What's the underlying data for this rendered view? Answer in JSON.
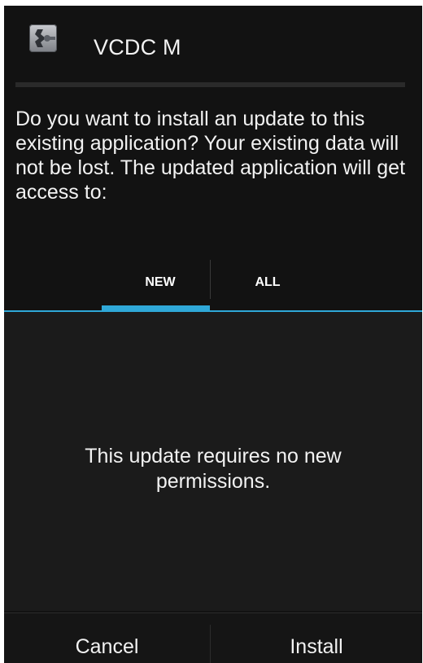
{
  "app": {
    "title": "VCDC M",
    "icon": "app-wrench-icon"
  },
  "dialog": {
    "message": "Do you want to install an update to this existing application? Your existing data will not be lost. The updated application will get access to:",
    "tabs": [
      {
        "label": "NEW",
        "selected": true
      },
      {
        "label": "ALL",
        "selected": false
      }
    ],
    "content_text": "This update requires no new permissions."
  },
  "buttons": {
    "cancel": "Cancel",
    "install": "Install"
  },
  "colors": {
    "accent": "#2fa8d8",
    "background": "#121212",
    "text": "#f2f2f2"
  }
}
